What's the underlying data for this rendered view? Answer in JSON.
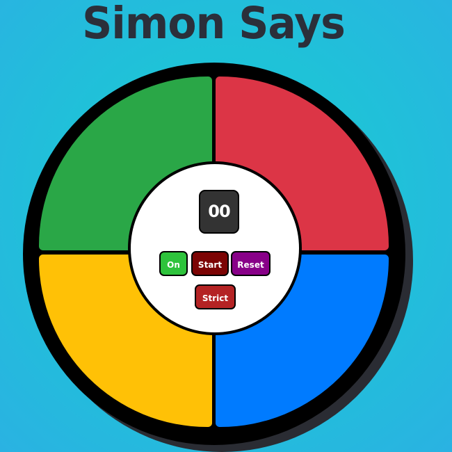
{
  "header": {
    "title": "Simon Says"
  },
  "board": {
    "pads": {
      "green": "#2aa747",
      "red": "#dc3546",
      "yellow": "#ffc106",
      "blue": "#007bff"
    }
  },
  "controls": {
    "count_display": "00",
    "on_label": "On",
    "start_label": "Start",
    "reset_label": "Reset",
    "strict_label": "Strict",
    "on_color": "#2ec33c",
    "start_color": "#7c0404",
    "reset_color": "#880088",
    "strict_color": "#b42324"
  }
}
